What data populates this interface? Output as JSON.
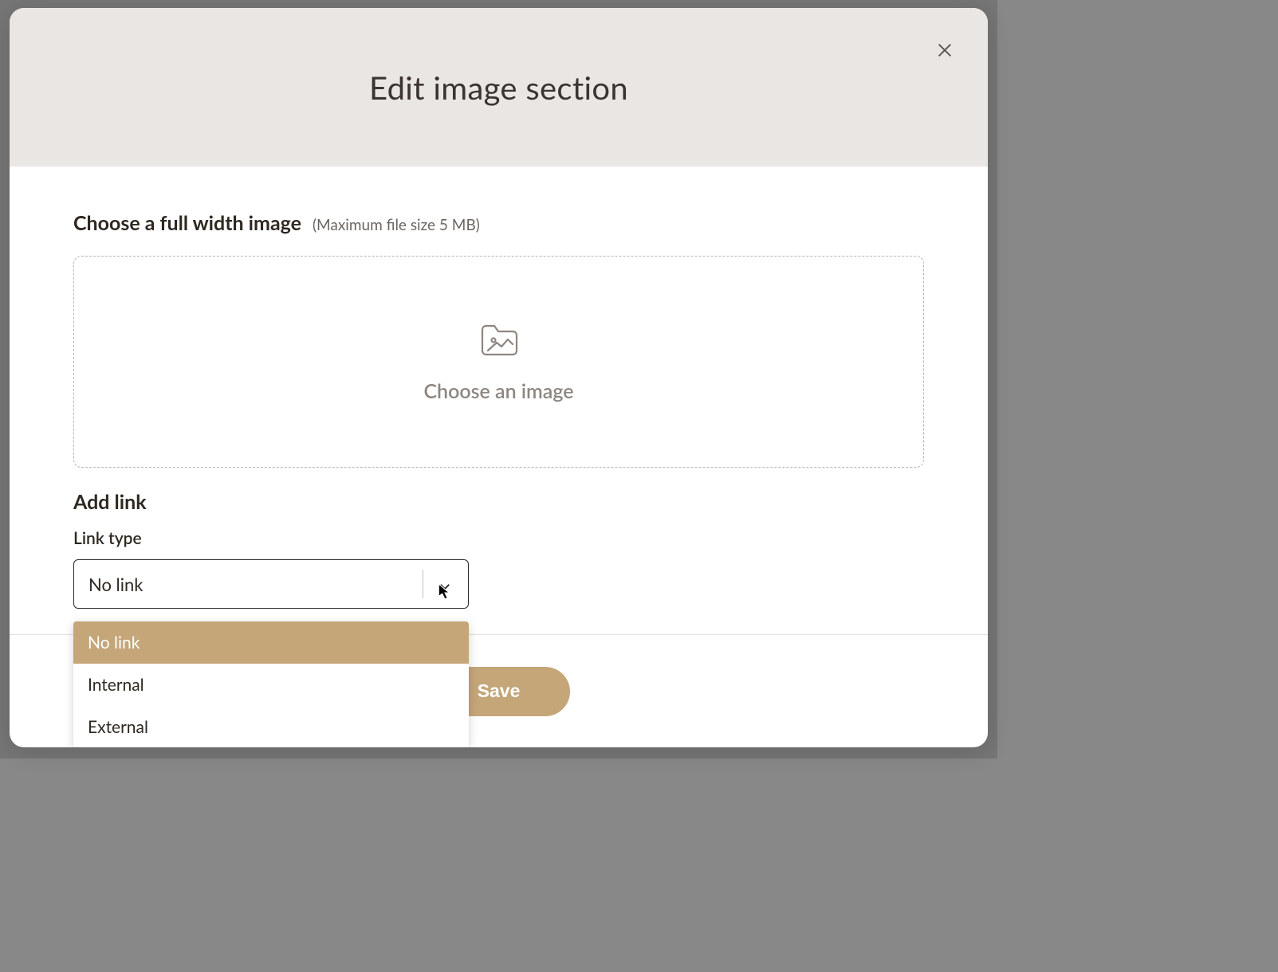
{
  "modal": {
    "title": "Edit image section",
    "section_heading": "Choose a full width image",
    "section_subtext": "(Maximum file size 5 MB)",
    "dropzone_text": "Choose an image",
    "add_link_heading": "Add link",
    "link_type_label": "Link type",
    "link_type_value": "No link",
    "link_type_options": [
      "No link",
      "Internal",
      "External"
    ],
    "save_label": "Save"
  },
  "colors": {
    "accent": "#c4a679",
    "header_bg": "#e9e6e4",
    "text_primary": "#2e2821",
    "text_muted": "#8d8680"
  }
}
